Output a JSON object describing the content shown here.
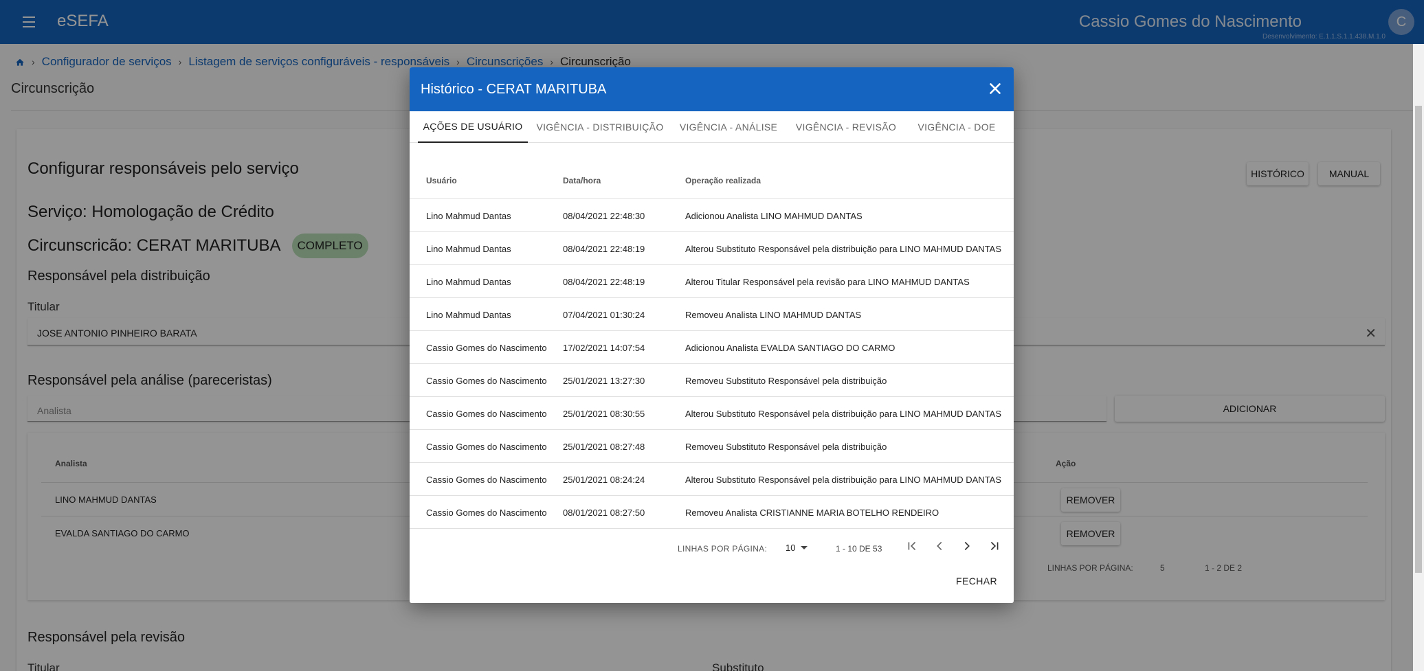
{
  "topbar": {
    "app_title": "eSEFA",
    "user_name": "Cassio Gomes do Nascimento",
    "env_info": "Desenvolvimento: E.1.1.S.1.1.438.M.1.0",
    "avatar_initial": "C"
  },
  "breadcrumb": {
    "items": [
      "Configurador de serviços",
      "Listagem de serviços configuráveis - responsáveis",
      "Circunscrições"
    ],
    "current": "Circunscrição"
  },
  "page": {
    "title": "Circunscrição",
    "card_heading": "Configurar responsáveis pelo serviço",
    "historico_button": "HISTÓRICO",
    "manual_button": "MANUAL",
    "service_line": "Serviço: Homologação de Crédito",
    "circ_line": "Circunscricão: CERAT MARITUBA",
    "status_badge": "COMPLETO",
    "dist_section": "Responsável pela distribuição",
    "titular_label": "Titular",
    "titular_value": "JOSE ANTONIO PINHEIRO BARATA",
    "analise_section": "Responsável pela análise (pareceristas)",
    "analista_placeholder": "Analista",
    "adicionar_button": "ADICIONAR",
    "analista_col": "Analista",
    "acao_col": "Ação",
    "analistas": [
      "LINO MAHMUD DANTAS",
      "EVALDA SANTIAGO DO CARMO"
    ],
    "remover_button": "REMOVER",
    "bg_rows_label": "LINHAS POR PÁGINA:",
    "bg_rows_value": "5",
    "bg_range": "1 - 2 DE 2",
    "revisao_section": "Responsável pela revisão",
    "revisao_titular": "Titular",
    "revisao_substituto": "Substituto"
  },
  "dialog": {
    "title": "Histórico - CERAT MARITUBA",
    "tabs": [
      {
        "label": "AÇÕES DE USUÁRIO",
        "active": true
      },
      {
        "label": "VIGÊNCIA - DISTRIBUIÇÃO",
        "active": false
      },
      {
        "label": "VIGÊNCIA - ANÁLISE",
        "active": false
      },
      {
        "label": "VIGÊNCIA - REVISÃO",
        "active": false
      },
      {
        "label": "VIGÊNCIA - DOE",
        "active": false
      }
    ],
    "columns": [
      "Usuário",
      "Data/hora",
      "Operação realizada"
    ],
    "rows": [
      {
        "user": "Lino Mahmud Dantas",
        "datetime": "08/04/2021 22:48:30",
        "operation": "Adicionou Analista LINO MAHMUD DANTAS"
      },
      {
        "user": "Lino Mahmud Dantas",
        "datetime": "08/04/2021 22:48:19",
        "operation": "Alterou Substituto Responsável pela distribuição para LINO MAHMUD DANTAS"
      },
      {
        "user": "Lino Mahmud Dantas",
        "datetime": "08/04/2021 22:48:19",
        "operation": "Alterou Titular Responsável pela revisão para LINO MAHMUD DANTAS"
      },
      {
        "user": "Lino Mahmud Dantas",
        "datetime": "07/04/2021 01:30:24",
        "operation": "Removeu Analista LINO MAHMUD DANTAS"
      },
      {
        "user": "Cassio Gomes do Nascimento",
        "datetime": "17/02/2021 14:07:54",
        "operation": "Adicionou Analista EVALDA SANTIAGO DO CARMO"
      },
      {
        "user": "Cassio Gomes do Nascimento",
        "datetime": "25/01/2021 13:27:30",
        "operation": "Removeu Substituto Responsável pela distribuição"
      },
      {
        "user": "Cassio Gomes do Nascimento",
        "datetime": "25/01/2021 08:30:55",
        "operation": "Alterou Substituto Responsável pela distribuição para LINO MAHMUD DANTAS"
      },
      {
        "user": "Cassio Gomes do Nascimento",
        "datetime": "25/01/2021 08:27:48",
        "operation": "Removeu Substituto Responsável pela distribuição"
      },
      {
        "user": "Cassio Gomes do Nascimento",
        "datetime": "25/01/2021 08:24:24",
        "operation": "Alterou Substituto Responsável pela distribuição para LINO MAHMUD DANTAS"
      },
      {
        "user": "Cassio Gomes do Nascimento",
        "datetime": "08/01/2021 08:27:50",
        "operation": "Removeu Analista CRISTIANNE MARIA BOTELHO RENDEIRO"
      }
    ],
    "pagination": {
      "rows_label": "LINHAS POR PÁGINA:",
      "rows_value": "10",
      "range": "1 - 10 DE 53"
    },
    "close_button": "FECHAR"
  },
  "colors": {
    "primary": "#1565c0",
    "badge": "#b9dfb7"
  }
}
